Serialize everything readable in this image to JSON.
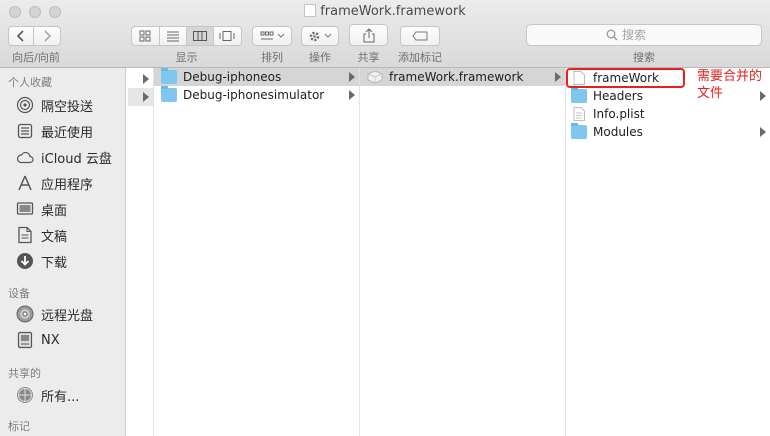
{
  "window": {
    "title": "frameWork.framework"
  },
  "toolbar": {
    "back_forward_label": "向后/向前",
    "view_label": "显示",
    "arrange_label": "排列",
    "action_label": "操作",
    "share_label": "共享",
    "tags_label": "添加标记",
    "search_label": "搜索",
    "search_placeholder": "搜索"
  },
  "sidebar": {
    "favorites_header": "个人收藏",
    "favorites": [
      {
        "label": "隔空投送",
        "icon": "airdrop-icon"
      },
      {
        "label": "最近使用",
        "icon": "recents-icon"
      },
      {
        "label": "iCloud 云盘",
        "icon": "cloud-icon"
      },
      {
        "label": "应用程序",
        "icon": "applications-icon"
      },
      {
        "label": "桌面",
        "icon": "desktop-icon"
      },
      {
        "label": "文稿",
        "icon": "document-icon"
      },
      {
        "label": "下载",
        "icon": "download-icon"
      }
    ],
    "devices_header": "设备",
    "devices": [
      {
        "label": "远程光盘",
        "icon": "disc-icon"
      },
      {
        "label": "NX",
        "icon": "drive-icon"
      }
    ],
    "shared_header": "共享的",
    "shared": [
      {
        "label": "所有...",
        "icon": "network-icon"
      }
    ],
    "tags_header": "标记"
  },
  "columns": {
    "col1": [
      {
        "name": "Debug-iphoneos",
        "type": "folder",
        "selected": true
      },
      {
        "name": "Debug-iphonesimulator",
        "type": "folder",
        "selected": false
      }
    ],
    "col2": [
      {
        "name": "frameWork.framework",
        "type": "framework",
        "selected": true
      }
    ],
    "col3": [
      {
        "name": "frameWork",
        "type": "file",
        "selected": false
      },
      {
        "name": "Headers",
        "type": "folder",
        "selected": false
      },
      {
        "name": "Info.plist",
        "type": "plist",
        "selected": false
      },
      {
        "name": "Modules",
        "type": "folder",
        "selected": false
      }
    ]
  },
  "annotation": {
    "text": "需要合并的文件",
    "color": "#e8201c"
  },
  "colors": {
    "selection": "#d5d5d5",
    "folder": "#7ec8f0",
    "sidebar_bg": "#ececec"
  }
}
